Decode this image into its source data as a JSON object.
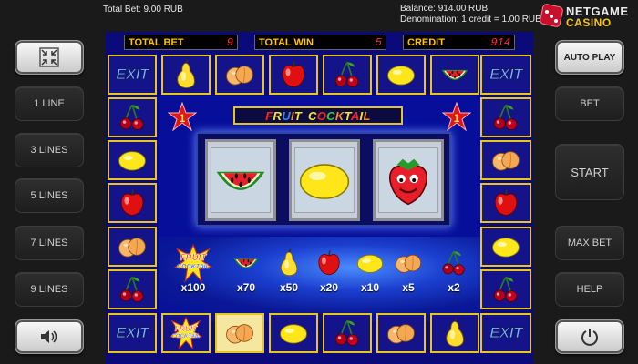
{
  "top": {
    "total_bet": "Total Bet: 9.00 RUB",
    "balance": "Balance: 914.00 RUB",
    "denomination": "Denomination: 1 credit = 1.00 RUB",
    "logo_line1": "NETGAME",
    "logo_line2": "CASINO"
  },
  "left_buttons": {
    "fullscreen_icon": "collapse-arrows-icon",
    "line1": "1 LINE",
    "line3": "3 LINES",
    "line5": "5 LINES",
    "line7": "7 LINES",
    "line9": "9 LINES",
    "sound_icon": "speaker-icon"
  },
  "right_buttons": {
    "auto_play": "AUTO PLAY",
    "bet": "BET",
    "start": "START",
    "max_bet": "MAX BET",
    "help": "HELP",
    "power_icon": "power-icon"
  },
  "hud": {
    "total_bet_label": "TOTAL BET",
    "total_bet_value": "9",
    "total_win_label": "TOTAL WIN",
    "total_win_value": "5",
    "credit_label": "CREDIT",
    "credit_value": "914"
  },
  "game_title": {
    "letters": [
      "F",
      "R",
      "U",
      "I",
      "T",
      " ",
      "C",
      "O",
      "C",
      "K",
      "T",
      "A",
      "I",
      "L"
    ]
  },
  "exit_label": "EXIT",
  "reels": [
    "watermelon",
    "lemon",
    "strawberry"
  ],
  "paytable": [
    {
      "symbol": "fruit-cocktail",
      "logo_line1": "FRUIT",
      "logo_line2": "COCKTAIL",
      "mult": "x100"
    },
    {
      "symbol": "watermelon",
      "mult": "x70"
    },
    {
      "symbol": "pear",
      "mult": "x50"
    },
    {
      "symbol": "apple",
      "mult": "x20"
    },
    {
      "symbol": "lemon",
      "mult": "x10"
    },
    {
      "symbol": "apricot",
      "mult": "x5"
    },
    {
      "symbol": "cherry",
      "mult": "x2"
    }
  ],
  "frame_top": [
    "exit",
    "pear",
    "apricot",
    "apple",
    "cherry",
    "lemon",
    "watermelon",
    "exit"
  ],
  "frame_left": [
    "cherry",
    "lemon",
    "apple",
    "apricot",
    "cherry"
  ],
  "frame_right": [
    "cherry",
    "apricot",
    "apple",
    "lemon",
    "cherry"
  ],
  "frame_bottom": [
    "exit",
    "fruit-cocktail",
    "apricot",
    "lemon",
    "cherry",
    "apricot",
    "pear",
    "exit"
  ],
  "colors": {
    "frame_gold": "#e8c51e",
    "hud_label": "#ffc400",
    "hud_value": "#ff3030",
    "field_blue": "#0a0a7a"
  }
}
